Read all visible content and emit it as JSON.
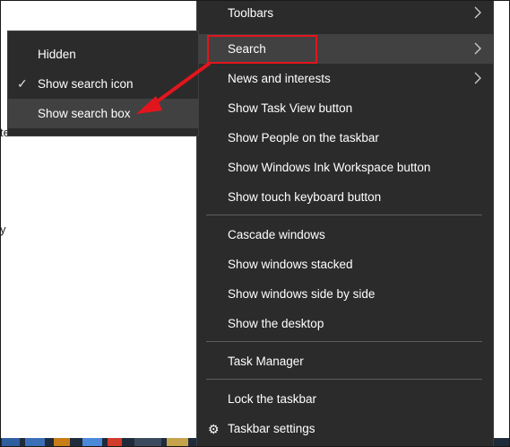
{
  "background": {
    "fragment_1": "te",
    "fragment_2": "y"
  },
  "main_menu": {
    "items": [
      {
        "label": "Toolbars",
        "has_submenu": true
      },
      {
        "label": "Search",
        "has_submenu": true,
        "highlighted": true
      },
      {
        "label": "News and interests",
        "has_submenu": true
      },
      {
        "label": "Show Task View button"
      },
      {
        "label": "Show People on the taskbar"
      },
      {
        "label": "Show Windows Ink Workspace button"
      },
      {
        "label": "Show touch keyboard button"
      },
      {
        "label": "Cascade windows"
      },
      {
        "label": "Show windows stacked"
      },
      {
        "label": "Show windows side by side"
      },
      {
        "label": "Show the desktop"
      },
      {
        "label": "Task Manager"
      },
      {
        "label": "Lock the taskbar"
      },
      {
        "label": "Taskbar settings",
        "icon": "gear-icon"
      }
    ]
  },
  "search_submenu": {
    "items": [
      {
        "label": "Hidden"
      },
      {
        "label": "Show search icon",
        "checked": true
      },
      {
        "label": "Show search box",
        "highlighted": true
      }
    ]
  },
  "colors": {
    "menu_bg": "#2b2b2b",
    "highlight_bg": "#414141",
    "annotation_red": "#e2151d"
  }
}
